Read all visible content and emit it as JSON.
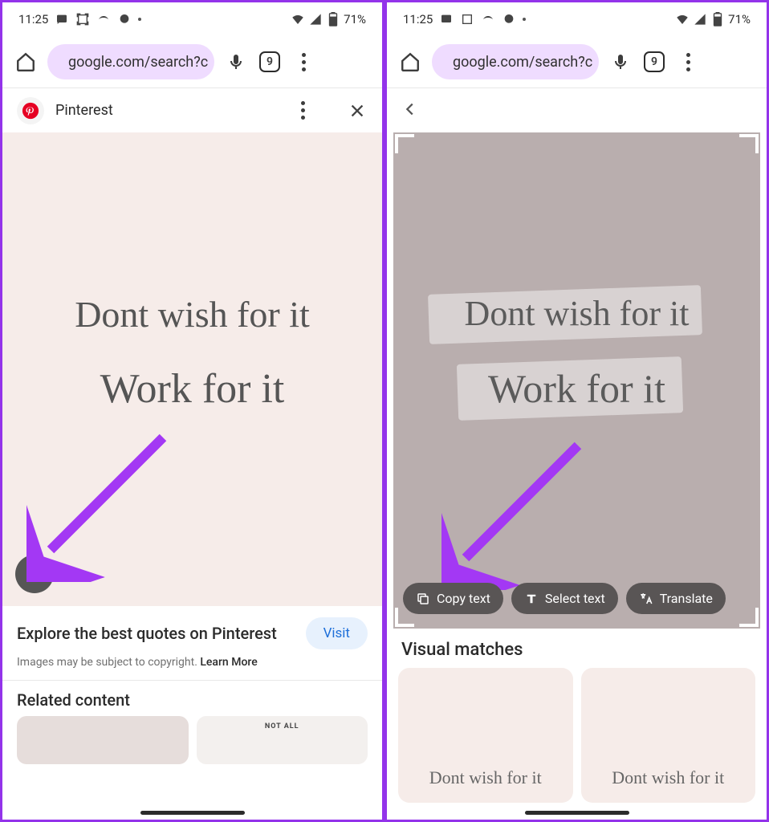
{
  "status": {
    "time": "11:25",
    "battery": "71%"
  },
  "browser": {
    "url": "google.com/search?c",
    "tabs": "9"
  },
  "left": {
    "source": "Pinterest",
    "image_text_1": "Dont wish for it",
    "image_text_2": "Work for it",
    "title": "Explore the best quotes on Pinterest",
    "visit": "Visit",
    "caption_pre": "Images may be subject to copyright. ",
    "caption_link": "Learn More",
    "related": "Related content",
    "thumb_b": "NOT ALL"
  },
  "right": {
    "image_text_1": "Dont wish for it",
    "image_text_2": "Work for it",
    "copy": "Copy text",
    "select": "Select text",
    "translate": "Translate",
    "vm_title": "Visual matches",
    "vm_text": "Dont wish for it"
  }
}
